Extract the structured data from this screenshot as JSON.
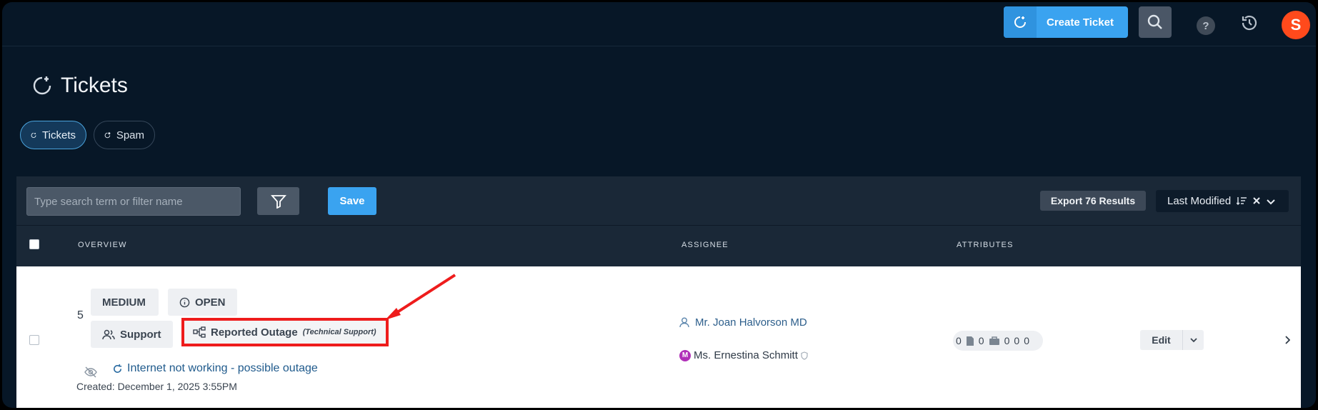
{
  "topbar": {
    "create_ticket_label": "Create Ticket",
    "help_label": "?",
    "avatar_letter": "S"
  },
  "page": {
    "title": "Tickets",
    "tabs": [
      {
        "label": "Tickets",
        "active": true
      },
      {
        "label": "Spam",
        "active": false
      }
    ]
  },
  "toolbar": {
    "search_placeholder": "Type search term or filter name",
    "save_label": "Save",
    "export_label": "Export 76 Results",
    "sort_label": "Last Modified"
  },
  "table": {
    "headers": {
      "overview": "OVERVIEW",
      "assignee": "ASSIGNEE",
      "attributes": "ATTRIBUTES"
    },
    "rows": [
      {
        "number": "5",
        "priority": "MEDIUM",
        "status": "OPEN",
        "group": "Support",
        "type": "Reported Outage",
        "type_sub": "(Technical Support)",
        "subject": "Internet not working - possible outage",
        "created": "Created: December 1, 2025 3:55PM",
        "assignee": "Mr. Joan Halvorson MD",
        "requester_badge": "M",
        "requester": "Ms. Ernestina Schmitt",
        "attr_a": "0",
        "attr_b": "0",
        "attr_c": "0",
        "attr_d": "0",
        "attr_e": "0",
        "edit_label": "Edit"
      }
    ]
  },
  "colors": {
    "accent": "#3aa3f0",
    "background": "#071727",
    "highlight": "#ee1c1c",
    "avatar": "#ff4a1c"
  }
}
